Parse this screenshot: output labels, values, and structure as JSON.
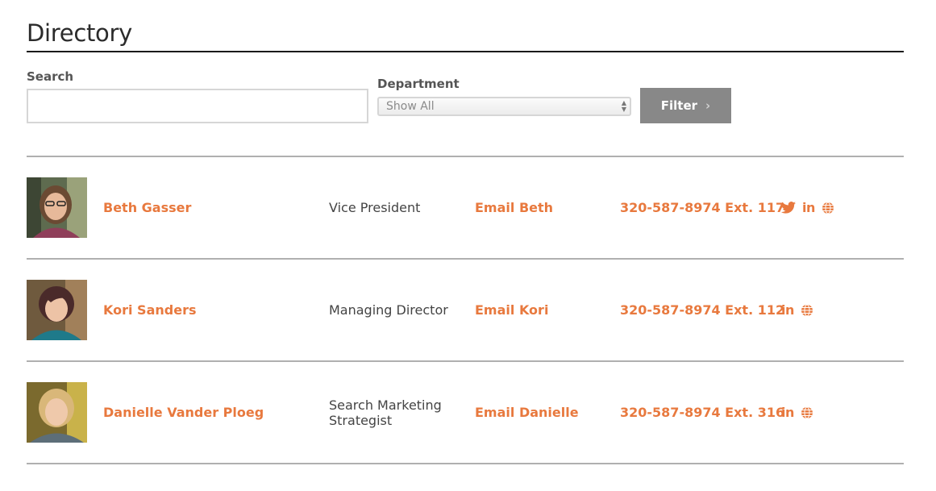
{
  "page": {
    "title": "Directory"
  },
  "filters": {
    "search_label": "Search",
    "search_value": "",
    "department_label": "Department",
    "department_selected": "Show All",
    "filter_button": "Filter"
  },
  "colors": {
    "accent": "#e8793e",
    "button": "#888888",
    "divider": "#b0b0b0"
  },
  "people": [
    {
      "name": "Beth Gasser",
      "title": "Vice President",
      "email_label": "Email Beth",
      "phone": "320-587-8974 Ext. 117",
      "socials": [
        "twitter-icon",
        "linkedin-icon",
        "globe-icon"
      ]
    },
    {
      "name": "Kori Sanders",
      "title": "Managing Director",
      "email_label": "Email Kori",
      "phone": "320-587-8974 Ext. 112",
      "socials": [
        "linkedin-icon",
        "globe-icon"
      ]
    },
    {
      "name": "Danielle Vander Ploeg",
      "title": "Search Marketing Strategist",
      "email_label": "Email Danielle",
      "phone": "320-587-8974 Ext. 316",
      "socials": [
        "linkedin-icon",
        "globe-icon"
      ]
    }
  ]
}
